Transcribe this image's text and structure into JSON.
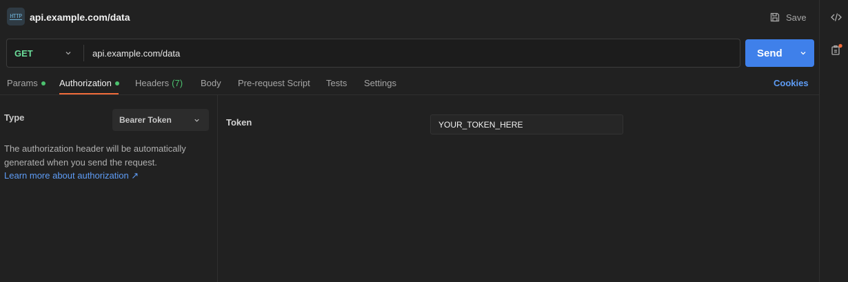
{
  "request": {
    "title": "api.example.com/data",
    "icon": "http-icon",
    "icon_text": "HTTP",
    "save_label": "Save",
    "method": "GET",
    "url": "api.example.com/data",
    "send_label": "Send"
  },
  "tabs": [
    {
      "label": "Params",
      "dot": true
    },
    {
      "label": "Authorization",
      "dot": true,
      "active": true
    },
    {
      "label": "Headers",
      "count": "(7)"
    },
    {
      "label": "Body"
    },
    {
      "label": "Pre-request Script"
    },
    {
      "label": "Tests"
    },
    {
      "label": "Settings"
    }
  ],
  "cookies_label": "Cookies",
  "auth": {
    "type_label": "Type",
    "type_value": "Bearer Token",
    "description": "The authorization header will be automatically generated when you send the request.",
    "learn_more": "Learn more about authorization ↗",
    "token_label": "Token",
    "token_value": "YOUR_TOKEN_HERE"
  },
  "rail": {
    "code_icon": "code-icon",
    "documentation_icon": "documentation-icon"
  },
  "colors": {
    "background": "#212121",
    "accent_send": "#3f80ea",
    "method_get": "#6bdd9a",
    "active_tab_underline": "#f26b3a",
    "status_dot": "#4cc26f",
    "link": "#5e9cf5",
    "notification_dot": "#f26b3a"
  }
}
